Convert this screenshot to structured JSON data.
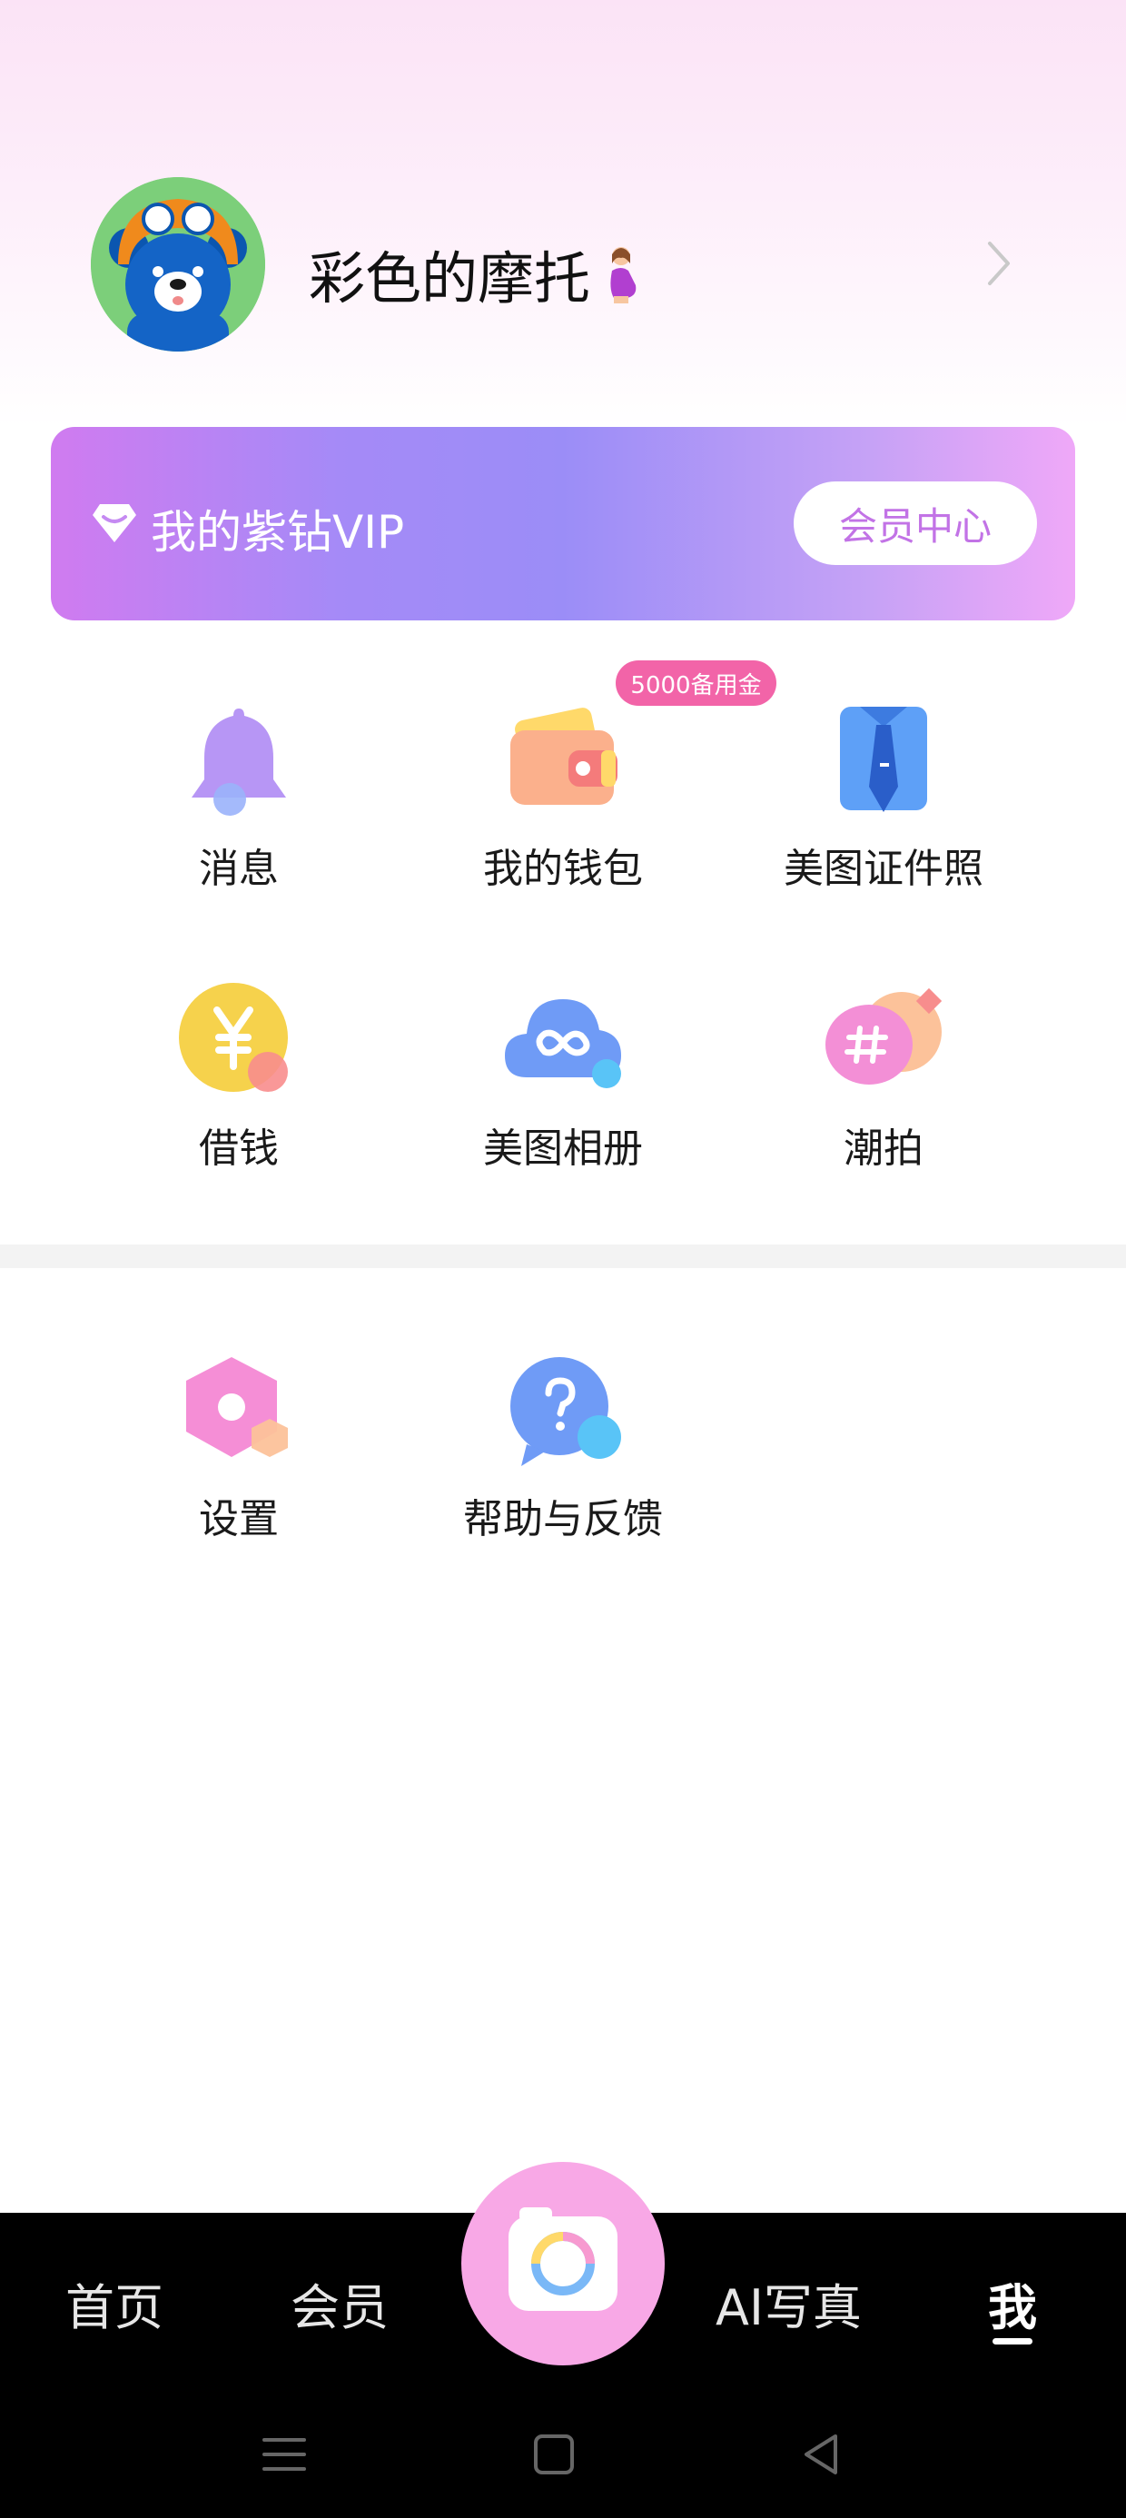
{
  "profile": {
    "username": "彩色的摩托",
    "name_emoji": "pregnant-woman-emoji",
    "avatar": "bear-with-goggles-avatar"
  },
  "vip": {
    "title": "我的紫钻VIP",
    "button": "会员中心"
  },
  "grid": [
    {
      "label": "消息",
      "icon": "bell-icon"
    },
    {
      "label": "我的钱包",
      "icon": "wallet-icon",
      "badge": "5000备用金"
    },
    {
      "label": "美图证件照",
      "icon": "id-photo-icon"
    },
    {
      "label": "借钱",
      "icon": "yuan-icon"
    },
    {
      "label": "美图相册",
      "icon": "cloud-album-icon"
    },
    {
      "label": "潮拍",
      "icon": "hashtag-icon"
    }
  ],
  "settings": [
    {
      "label": "设置",
      "icon": "settings-icon"
    },
    {
      "label": "帮助与反馈",
      "icon": "help-icon"
    }
  ],
  "nav": {
    "items": [
      "首页",
      "会员",
      "AI写真",
      "我"
    ],
    "active": "我"
  },
  "colors": {
    "accent_pink": "#f264a8",
    "vip_purple": "#9b8df7",
    "nav_bg": "#000000"
  }
}
